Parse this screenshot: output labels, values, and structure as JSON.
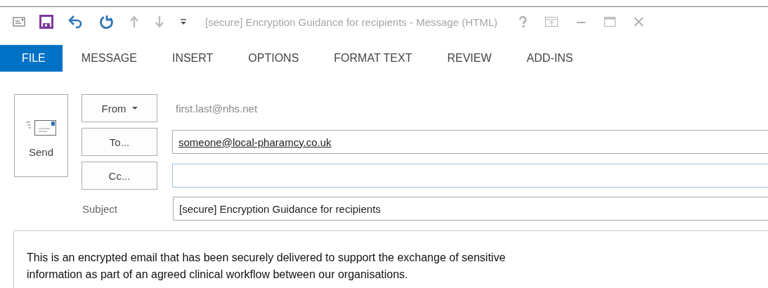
{
  "quick_access": [
    {
      "kind": "envelope",
      "disabled": false
    },
    {
      "kind": "save",
      "disabled": false
    },
    {
      "kind": "undo",
      "disabled": false
    },
    {
      "kind": "redo",
      "disabled": false
    },
    {
      "kind": "up",
      "disabled": true
    },
    {
      "kind": "down",
      "disabled": true
    },
    {
      "kind": "customize",
      "disabled": false
    }
  ],
  "window": {
    "title": "[secure] Encryption Guidance for recipients - Message (HTML)"
  },
  "ribbon": {
    "tabs": [
      {
        "label": "FILE",
        "selected": true
      },
      {
        "label": "MESSAGE",
        "selected": false
      },
      {
        "label": "INSERT",
        "selected": false
      },
      {
        "label": "OPTIONS",
        "selected": false
      },
      {
        "label": "FORMAT TEXT",
        "selected": false
      },
      {
        "label": "REVIEW",
        "selected": false
      },
      {
        "label": "ADD-INS",
        "selected": false
      }
    ]
  },
  "send_button": {
    "label": "Send"
  },
  "fields": [
    {
      "kind": "from",
      "button": "From",
      "value": "first.last@nhs.net"
    },
    {
      "kind": "address",
      "button": "To...",
      "value": "someone@local-pharamcy.co.uk",
      "focused": false
    },
    {
      "kind": "address",
      "button": "Cc...",
      "focused": true
    },
    {
      "kind": "subject",
      "label": "Subject",
      "value": "[secure] Encryption Guidance for recipients",
      "focused": false
    }
  ],
  "body": {
    "paragraphs": [
      "This is an encrypted email that has been securely delivered to support the exchange of sensitive information as part of an agreed clinical workflow between our organisations."
    ]
  }
}
